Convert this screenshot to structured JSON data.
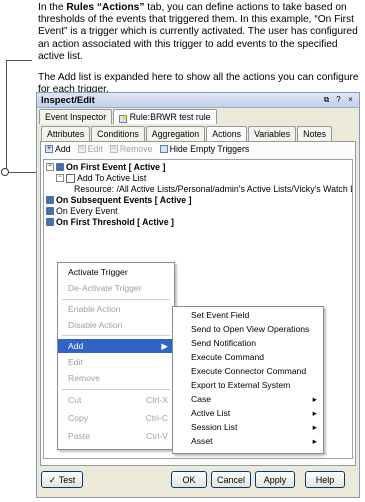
{
  "caption": {
    "p1_a": "In the ",
    "p1_bold": "Rules “Actions”",
    "p1_b": " tab, you can define actions to take based on thresholds of the events that triggered them. In this example, “On First Event” is a trigger which is currently activated. The user has configured an action associated with this trigger to add events to the specified active list.",
    "p2": "The Add list is expanded here to show all the actions you can configure for each trigger."
  },
  "window": {
    "title": "Inspect/Edit",
    "controls": [
      "⧉",
      "?",
      "×"
    ],
    "top_tabs": [
      "Event Inspector",
      "Rule:BRWR test rule"
    ],
    "sub_tabs": [
      "Attributes",
      "Conditions",
      "Aggregation",
      "Actions",
      "Variables",
      "Notes"
    ]
  },
  "toolbar": {
    "add": "Add",
    "edit": "Edit",
    "remove": "Remove",
    "hide_empty": "Hide Empty Triggers"
  },
  "tree": {
    "on_first_event": "On First Event [ Active ]",
    "add_to_active_list": "Add To Active List",
    "resource": "Resource: /All Active Lists/Personal/admin's Active Lists/Vicky's Watch List",
    "on_subsequent": "On Subsequent Events [ Active ]",
    "on_every": "On Every Event",
    "on_first_threshold": "On First Threshold [ Active ]"
  },
  "context_menu": {
    "activate": "Activate Trigger",
    "deactivate": "De-Activate Trigger",
    "enable": "Enable Action",
    "disable": "Disable Action",
    "add": "Add",
    "edit": "Edit",
    "remove": "Remove",
    "cut": "Cut",
    "cut_sc": "Ctrl-X",
    "copy": "Copy",
    "copy_sc": "Ctrl-C",
    "paste": "Paste",
    "paste_sc": "Ctrl-V"
  },
  "submenu": {
    "items": [
      "Set Event Field",
      "Send to Open View Operations",
      "Send Notification",
      "Execute Command",
      "Execute Connector Command",
      "Export to External System",
      "Case",
      "Active List",
      "Session List",
      "Asset"
    ]
  },
  "buttons": {
    "test": "Test",
    "ok": "OK",
    "cancel": "Cancel",
    "apply": "Apply",
    "help": "Help"
  }
}
